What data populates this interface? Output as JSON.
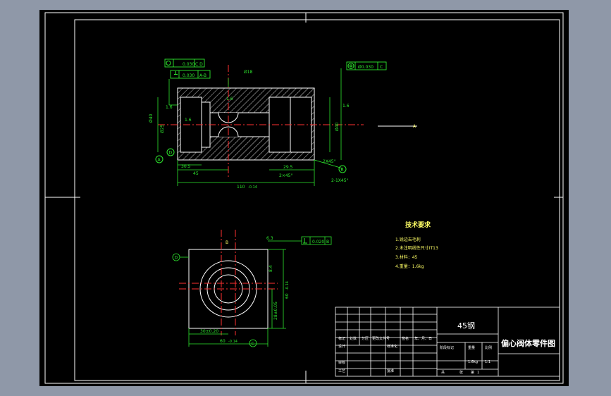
{
  "section_label": "A",
  "view_front": {
    "callouts": {
      "position_value": "0.030",
      "position_datum": "C D",
      "flatness_value": "0.030",
      "flatness_datum": "A-B",
      "right_value": "Ø0.030",
      "right_datum": "C",
      "bore_dim": "Ø18",
      "chamfer_main": "2X45°",
      "chamfer_small": "2-1X45°",
      "length_left1": "30.5",
      "length_left2": "45",
      "length_right": "29.5",
      "length_total": "110",
      "len_tol": "-0.14",
      "roughness_1": "1.6",
      "roughness_2": "1.6",
      "roughness_3": "1.6",
      "roughness_4": "1.6",
      "dia_left": "Ø40",
      "dia_right": "Ø40",
      "dia_mid": "Ø25",
      "chamfer_side": "2×45°"
    },
    "datum_a": "A",
    "datum_b": "B",
    "datum_d": "D"
  },
  "view_side": {
    "center_label": "B",
    "flatness_value": "0.020",
    "flatness_datum": "B",
    "roughness": "6.3",
    "width_dim": "30±0.20",
    "base_dim": "60",
    "base_tol": "-0.14",
    "height_dim": "28±0.05",
    "height_total": "60",
    "height_tol": "-0.14",
    "top_dim": "8.4",
    "datum_d": "D",
    "datum_c": "C"
  },
  "tech": {
    "title": "技术要求",
    "items": [
      "1.锐边去毛刺",
      "2.未注明线性尺寸IT13",
      "3.材料：45",
      "4.重量：1.6kg"
    ]
  },
  "title_block": {
    "material": "45钢",
    "part_name": "偏心阀体零件图",
    "row_headers": [
      "标记",
      "处数",
      "分区",
      "更改文件号",
      "签名",
      "年、月、日"
    ],
    "designer_label": "设计",
    "std_label": "标准化",
    "review_label": "审核",
    "process_label": "工艺",
    "approve_label": "批准",
    "stage_label": "阶段标记",
    "weight_label": "重量",
    "scale_label": "比例",
    "weight_value": "1.6kg",
    "scale_value": "1:1",
    "total_label": "共",
    "sheet_label": "张",
    "sheet_num_label": "第",
    "sheet_num": "1"
  }
}
